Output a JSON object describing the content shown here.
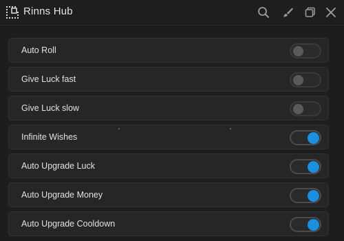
{
  "window": {
    "title": "Rinns Hub",
    "accent_color": "#1b8fe0",
    "icons": [
      "grid-dots-icon",
      "search-icon",
      "brush-icon",
      "restore-icon",
      "close-icon"
    ]
  },
  "toggles": [
    {
      "label": "Auto Roll",
      "on": false
    },
    {
      "label": "Give Luck fast",
      "on": false
    },
    {
      "label": "Give Luck slow",
      "on": false
    },
    {
      "label": "Infinite Wishes",
      "on": true
    },
    {
      "label": "Auto Upgrade Luck",
      "on": true
    },
    {
      "label": "Auto Upgrade Money",
      "on": true
    },
    {
      "label": "Auto Upgrade Cooldown",
      "on": true
    }
  ]
}
